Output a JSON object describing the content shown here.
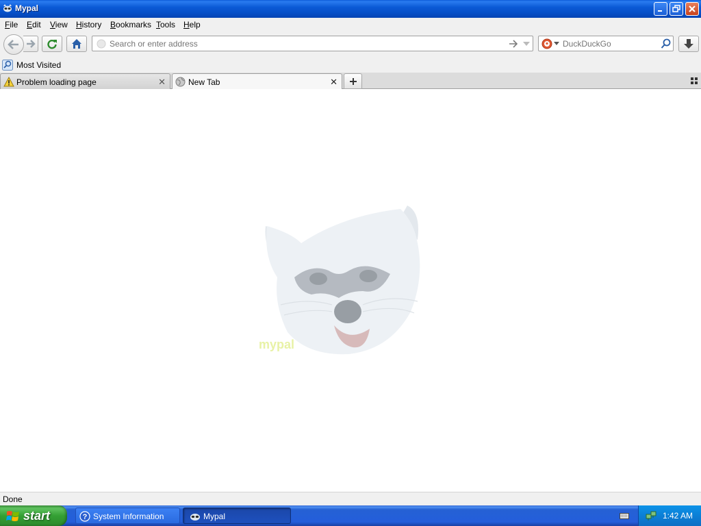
{
  "window": {
    "title": "Mypal"
  },
  "menu": {
    "file": {
      "ul": "F",
      "rest": "ile"
    },
    "edit": {
      "ul": "E",
      "rest": "dit"
    },
    "view": {
      "ul": "V",
      "rest": "iew"
    },
    "history": {
      "ul": "H",
      "rest": "istory"
    },
    "bookmarks": {
      "ul": "B",
      "rest": "ookmarks"
    },
    "tools": {
      "ul": "T",
      "rest": "ools"
    },
    "help": {
      "ul": "H",
      "rest": "elp"
    }
  },
  "navbar": {
    "address_placeholder": "Search or enter address",
    "address_value": "",
    "search_engine": "DuckDuckGo",
    "search_placeholder": "DuckDuckGo"
  },
  "bookmarks": {
    "most_visited": "Most Visited"
  },
  "tabs": [
    {
      "label": "Problem loading page",
      "icon": "warning-icon",
      "active": false
    },
    {
      "label": "New Tab",
      "icon": "globe-icon",
      "active": true
    }
  ],
  "content": {
    "logo_text": "mypal"
  },
  "status": {
    "text": "Done"
  },
  "taskbar": {
    "start_label": "start",
    "tasks": [
      {
        "label": "System Information",
        "icon": "help-icon",
        "active": false
      },
      {
        "label": "Mypal",
        "icon": "raccoon-icon",
        "active": true
      }
    ],
    "clock": "1:42 AM"
  },
  "colors": {
    "titlebar": "#0a5ad8",
    "taskbar": "#245edb",
    "start_button": "#34a034",
    "tray": "#0b7fd6"
  }
}
